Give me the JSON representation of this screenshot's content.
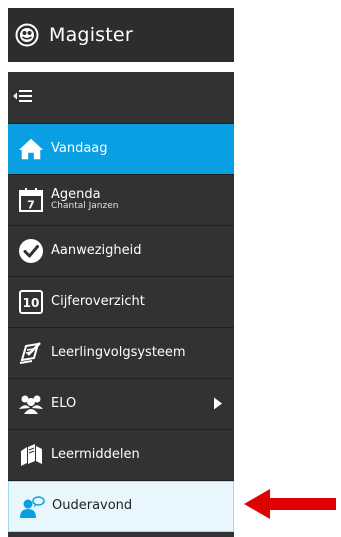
{
  "header": {
    "title": "Magister"
  },
  "sidebar": {
    "items": [
      {
        "label": "Vandaag",
        "icon": "home-icon"
      },
      {
        "label": "Agenda",
        "sublabel": "Chantal Janzen",
        "icon": "calendar-icon"
      },
      {
        "label": "Aanwezigheid",
        "icon": "check-circle-icon"
      },
      {
        "label": "Cijferoverzicht",
        "icon": "grade-10-icon"
      },
      {
        "label": "Leerlingvolgsysteem",
        "icon": "pen-book-icon"
      },
      {
        "label": "ELO",
        "icon": "group-people-icon"
      },
      {
        "label": "Leermiddelen",
        "icon": "books-icon"
      },
      {
        "label": "Ouderavond",
        "icon": "parent-chat-icon"
      }
    ],
    "calendar_day": "7",
    "grade_value": "10"
  },
  "colors": {
    "header_bg": "#2d2d2d",
    "sidebar_bg": "#323232",
    "active_bg": "#0a9ee2",
    "highlight_bg": "#e8f7fd",
    "arrow": "#e00000"
  }
}
